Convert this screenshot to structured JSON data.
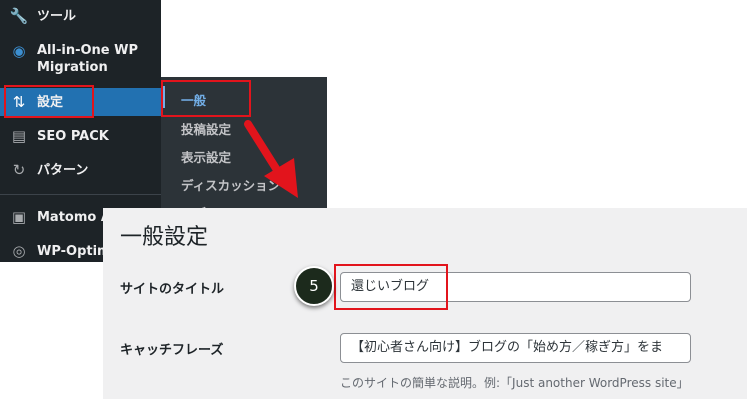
{
  "sidebar": {
    "items": [
      {
        "label": "ツール",
        "icon": "wrench-icon",
        "glyph": "🔧"
      },
      {
        "label": "All-in-One WP\nMigration",
        "icon": "migration-icon",
        "glyph": "◉"
      },
      {
        "label": "設定",
        "icon": "settings-icon",
        "glyph": "⇅"
      },
      {
        "label": "SEO PACK",
        "icon": "seo-pack-icon",
        "glyph": "▤"
      },
      {
        "label": "パターン",
        "icon": "patterns-icon",
        "glyph": "↻"
      },
      {
        "label": "Matomo A",
        "icon": "matomo-icon",
        "glyph": "▣"
      },
      {
        "label": "WP-Optim",
        "icon": "wp-optimize-icon",
        "glyph": "◎"
      }
    ]
  },
  "submenu": {
    "items": [
      "一般",
      "投稿設定",
      "表示設定",
      "ディスカッション",
      "メディア"
    ]
  },
  "settings": {
    "title": "一般設定",
    "site_title_label": "サイトのタイトル",
    "site_title_value": "還じいブログ",
    "tagline_label": "キャッチフレーズ",
    "tagline_value": "【初心者さん向け】ブログの「始め方／稼ぎ方」をま",
    "tagline_description": "このサイトの簡単な説明。例:「Just another WordPress site」"
  },
  "annotation": {
    "step_number": "5",
    "highlight_color": "#e2141c"
  }
}
